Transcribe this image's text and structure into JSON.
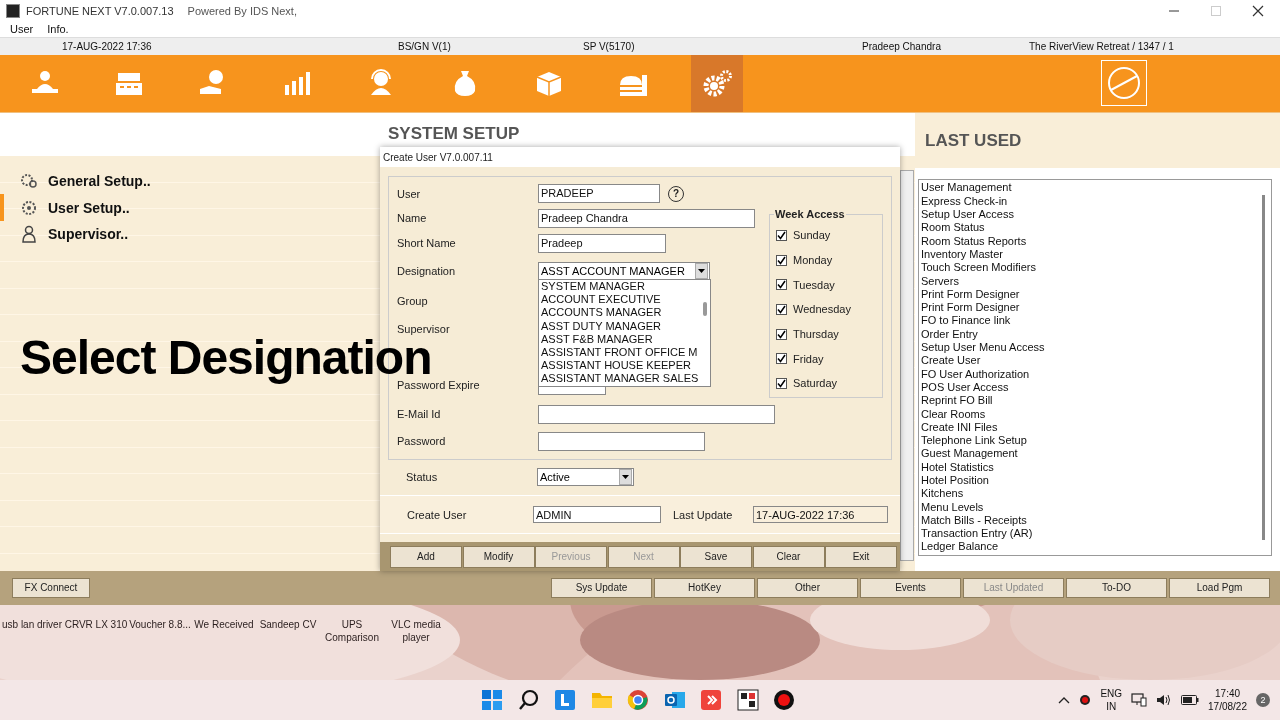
{
  "window": {
    "title": "FORTUNE NEXT  V7.0.007.13",
    "subtitle": "Powered By IDS Next,"
  },
  "menu": [
    "User",
    "Info."
  ],
  "info_bar": [
    "17-AUG-2022 17:36",
    "BS/GN V(1)",
    "SP V(5170)",
    "Pradeep Chandra",
    "The RiverView Retreat / 1347 / 1"
  ],
  "toolbar": [
    {
      "kind": "reception",
      "selected": false
    },
    {
      "kind": "register",
      "selected": false
    },
    {
      "kind": "payment",
      "selected": false
    },
    {
      "kind": "chart",
      "selected": false
    },
    {
      "kind": "headset",
      "selected": false
    },
    {
      "kind": "moneybag",
      "selected": false
    },
    {
      "kind": "boxes",
      "selected": false
    },
    {
      "kind": "food",
      "selected": false
    },
    {
      "kind": "gears",
      "selected": true
    }
  ],
  "section_title": "SYSTEM SETUP",
  "setup_menu": [
    {
      "label": "General Setup..",
      "kind": "gears",
      "selected": false
    },
    {
      "label": "User Setup..",
      "kind": "users",
      "selected": true
    },
    {
      "label": "Supervisor..",
      "kind": "person",
      "selected": false
    }
  ],
  "caption": "Select Designation",
  "dialog": {
    "title": "Create User V7.0.007.11",
    "fields": [
      {
        "kind": "text",
        "label": "User",
        "value": "PRADEEP",
        "help": "?"
      },
      {
        "kind": "text",
        "label": "Name",
        "value": "Pradeep Chandra"
      },
      {
        "kind": "text",
        "label": "Short Name",
        "value": "Pradeep"
      },
      {
        "kind": "combo",
        "label": "Designation",
        "value": "ASST ACCOUNT MANAGER",
        "expanded": true,
        "options": [
          "SYSTEM MANAGER",
          "ACCOUNT EXECUTIVE",
          "ACCOUNTS MANAGER",
          "ASST DUTY MANAGER",
          "ASST F&B MANAGER",
          "ASSISTANT FRONT OFFICE M",
          "ASSISTANT HOUSE KEEPER",
          "ASSISTANT MANAGER SALES"
        ]
      },
      {
        "kind": "label",
        "label": "Group"
      },
      {
        "kind": "label",
        "label": "Supervisor"
      },
      {
        "kind": "text",
        "label": "Password Expire"
      },
      {
        "kind": "text",
        "label": "E-Mail Id"
      },
      {
        "kind": "text",
        "label": "Password"
      }
    ],
    "week_access": {
      "title": "Week Access",
      "days": [
        {
          "label": "Sunday",
          "checked": true
        },
        {
          "label": "Monday",
          "checked": true
        },
        {
          "label": "Tuesday",
          "checked": true
        },
        {
          "label": "Wednesday",
          "checked": true
        },
        {
          "label": "Thursday",
          "checked": true
        },
        {
          "label": "Friday",
          "checked": true
        },
        {
          "label": "Saturday",
          "checked": true
        }
      ]
    },
    "status": {
      "label": "Status",
      "value": "Active"
    },
    "create_user": {
      "label": "Create User",
      "value": "ADMIN"
    },
    "last_update": {
      "label": "Last Update",
      "value": "17-AUG-2022  17:36"
    },
    "buttons": [
      {
        "label": "Add",
        "disabled": false
      },
      {
        "label": "Modify",
        "disabled": false
      },
      {
        "label": "Previous",
        "disabled": true
      },
      {
        "label": "Next",
        "disabled": true
      },
      {
        "label": "Save",
        "disabled": false
      },
      {
        "label": "Clear",
        "disabled": false
      },
      {
        "label": "Exit",
        "disabled": false
      }
    ]
  },
  "last_used": {
    "title": "LAST USED",
    "items": [
      "User Management",
      "Express Check-in",
      "Setup User Access",
      "Room Status",
      "Room Status Reports",
      "Inventory Master",
      "Touch Screen Modifiers",
      "Servers",
      "Print Form Designer",
      "Print Form Designer",
      "FO to Finance link",
      "Order Entry",
      "Setup User Menu Access",
      "Create User",
      "FO User Authorization",
      "POS User Access",
      "Reprint FO Bill",
      "Clear Rooms",
      "Create INI Files",
      "Telephone Link Setup",
      "Guest Management",
      "Hotel Statistics",
      "Hotel Position",
      "Kitchens",
      "Menu Levels",
      "Match Bills - Receipts",
      "Transaction Entry (AR)",
      "Ledger Balance"
    ]
  },
  "bottom_left_button": {
    "label": "FX Connect"
  },
  "bottom_buttons": [
    {
      "label": "Sys Update",
      "disabled": false
    },
    {
      "label": "HotKey",
      "disabled": false
    },
    {
      "label": "Other",
      "disabled": false
    },
    {
      "label": "Events",
      "disabled": false
    },
    {
      "label": "Last Updated",
      "disabled": true
    },
    {
      "label": "To-DO",
      "disabled": false
    },
    {
      "label": "Load Pgm",
      "disabled": false
    }
  ],
  "desktop_icons": [
    "usb lan driver",
    "CRVR LX 310",
    "Voucher 8.8...",
    "We Received",
    "Sandeep CV",
    "UPS Comparison",
    "VLC media player"
  ],
  "taskbar": {
    "apps": [
      {
        "kind": "start"
      },
      {
        "kind": "search"
      },
      {
        "kind": "tile-blue"
      },
      {
        "kind": "folder"
      },
      {
        "kind": "browser"
      },
      {
        "kind": "mail"
      },
      {
        "kind": "remote"
      },
      {
        "kind": "tile-app"
      },
      {
        "kind": "record"
      }
    ],
    "language": [
      "ENG",
      "IN"
    ],
    "time": "17:40",
    "date": "17/08/22",
    "notifications": "2"
  }
}
